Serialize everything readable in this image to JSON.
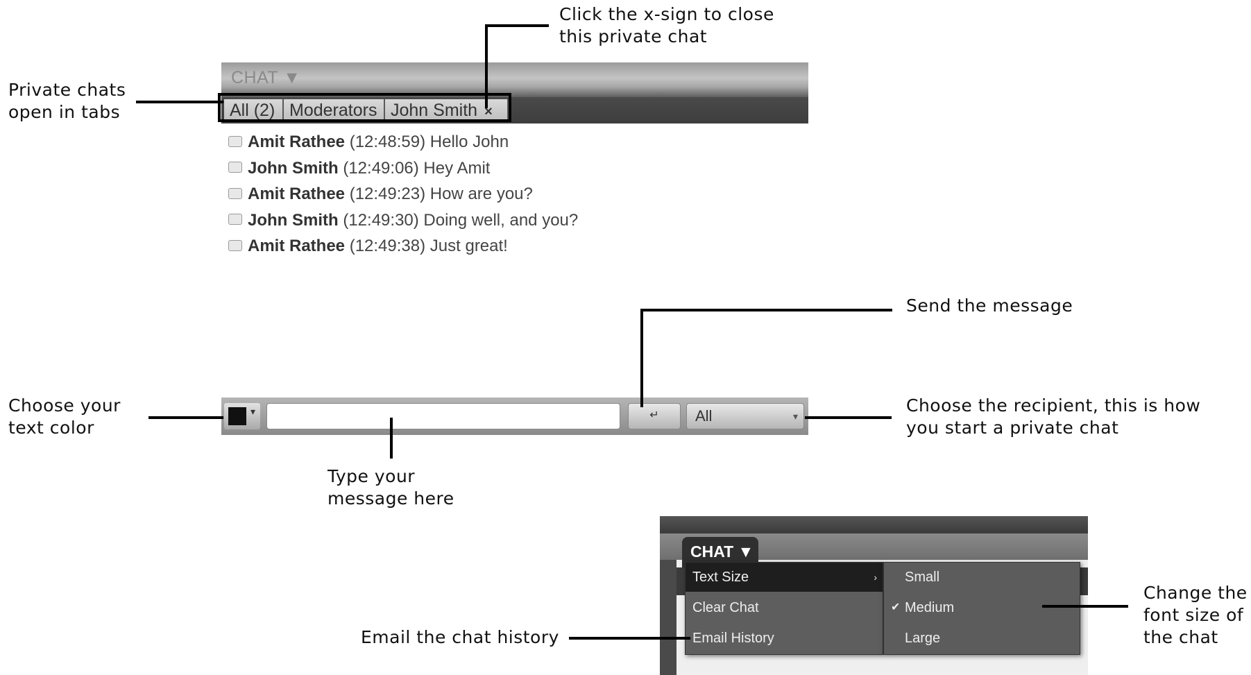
{
  "callouts": {
    "tabs": "Private chats\nopen in tabs",
    "close": "Click the x-sign to close\nthis private chat",
    "send": "Send the message",
    "color": "Choose your\ntext color",
    "recipient": "Choose the recipient, this is how\nyou start a private chat",
    "type": "Type your\nmessage here",
    "email": "Email the chat history",
    "font_size": "Change the\nfont size of\nthe chat"
  },
  "chat": {
    "header_label": "CHAT ▼",
    "tabs": [
      {
        "label": "All (2)"
      },
      {
        "label": "Moderators"
      },
      {
        "label": "John Smith",
        "close": "×"
      }
    ],
    "messages": [
      {
        "sender": "Amit Rathee",
        "time": "(12:48:59)",
        "text": "Hello John"
      },
      {
        "sender": "John Smith",
        "time": "(12:49:06)",
        "text": "Hey Amit"
      },
      {
        "sender": "Amit Rathee",
        "time": "(12:49:23)",
        "text": "How are you?"
      },
      {
        "sender": "John Smith",
        "time": "(12:49:30)",
        "text": "Doing well, and you?"
      },
      {
        "sender": "Amit Rathee",
        "time": "(12:49:38)",
        "text": "Just great!"
      }
    ],
    "input_placeholder": "",
    "send_icon": "↵",
    "recipient_value": "All",
    "text_color": "#111111"
  },
  "menu": {
    "header_label": "CHAT ▼",
    "items": [
      "Text Size",
      "Clear Chat",
      "Email History"
    ],
    "text_size_options": [
      "Small",
      "Medium",
      "Large"
    ],
    "selected_size": "Medium",
    "check_mark": "✔"
  }
}
